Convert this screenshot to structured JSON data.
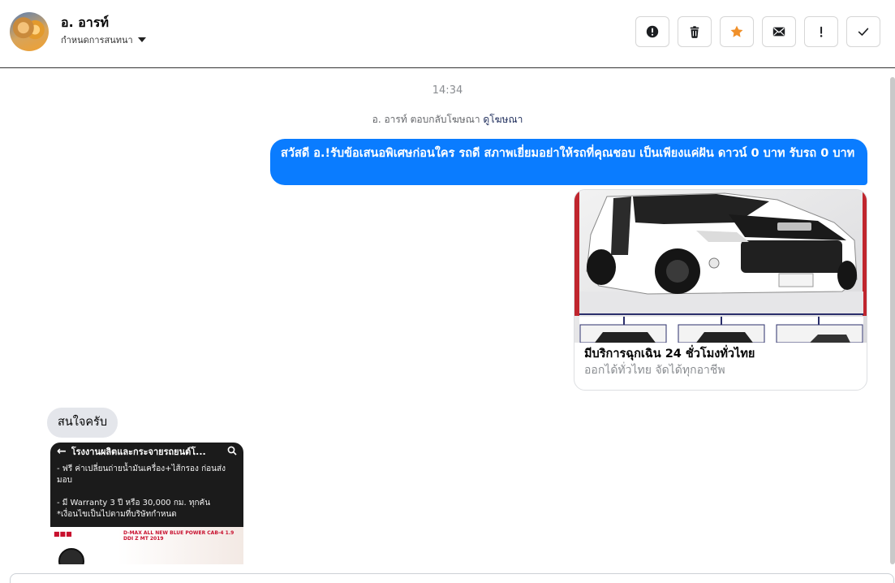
{
  "header": {
    "contact_name": "อ. อารท์",
    "nickname_label": "กำหนดการสนทนา",
    "actions": [
      {
        "name": "report-button",
        "icon": "alert-circle-icon"
      },
      {
        "name": "delete-button",
        "icon": "trash-icon"
      },
      {
        "name": "star-button",
        "icon": "star-icon",
        "color": "#f0902a"
      },
      {
        "name": "mark-unread-button",
        "icon": "envelope-icon"
      },
      {
        "name": "important-button",
        "icon": "exclamation-icon"
      },
      {
        "name": "done-button",
        "icon": "check-icon"
      }
    ]
  },
  "conversation": {
    "timestamp": "14:34",
    "reply_note": {
      "text": "อ. อารท์ ตอบกลับโฆษณา",
      "link": "ดูโฆษณา"
    },
    "outgoing_message": "สวัสดี อ.!รับข้อเสนอพิเศษก่อนใคร รถดี สภาพเยี่ยมอย่าให้รถที่คุณชอบ เป็นเพียงแค่ฝัน ดาวน์ 0 บาท รับรถ 0 บาท",
    "ad_card": {
      "title": "มีบริการฉุกเฉิน 24 ชั่วโมงทั่วไทย",
      "subtitle": "ออกได้ทั่วไทย จัดได้ทุกอาชีพ"
    },
    "incoming_message": "สนใจครับ",
    "screenshot": {
      "header_title": "โรงงานผลิตและกระจายรถยนต์โ...",
      "line1": "- ฟรี ค่าเปลี่ยนถ่ายน้ำมันเครื่อง+ไส้กรอง ก่อนส่งมอบ",
      "line2": "- มี Warranty 3 ปี หรือ 30,000 กม. ทุกคัน",
      "line3": "*เงื่อนไขเป็นไปตามที่บริษัทกำหนด",
      "banner_model": "D-MAX ALL NEW BLUE POWER CAB-4 1.9 DDI Z MT 2019"
    }
  },
  "colors": {
    "outgoing_bubble": "#0a7cff",
    "incoming_bubble": "#e4e6eb",
    "star": "#f0902a"
  }
}
